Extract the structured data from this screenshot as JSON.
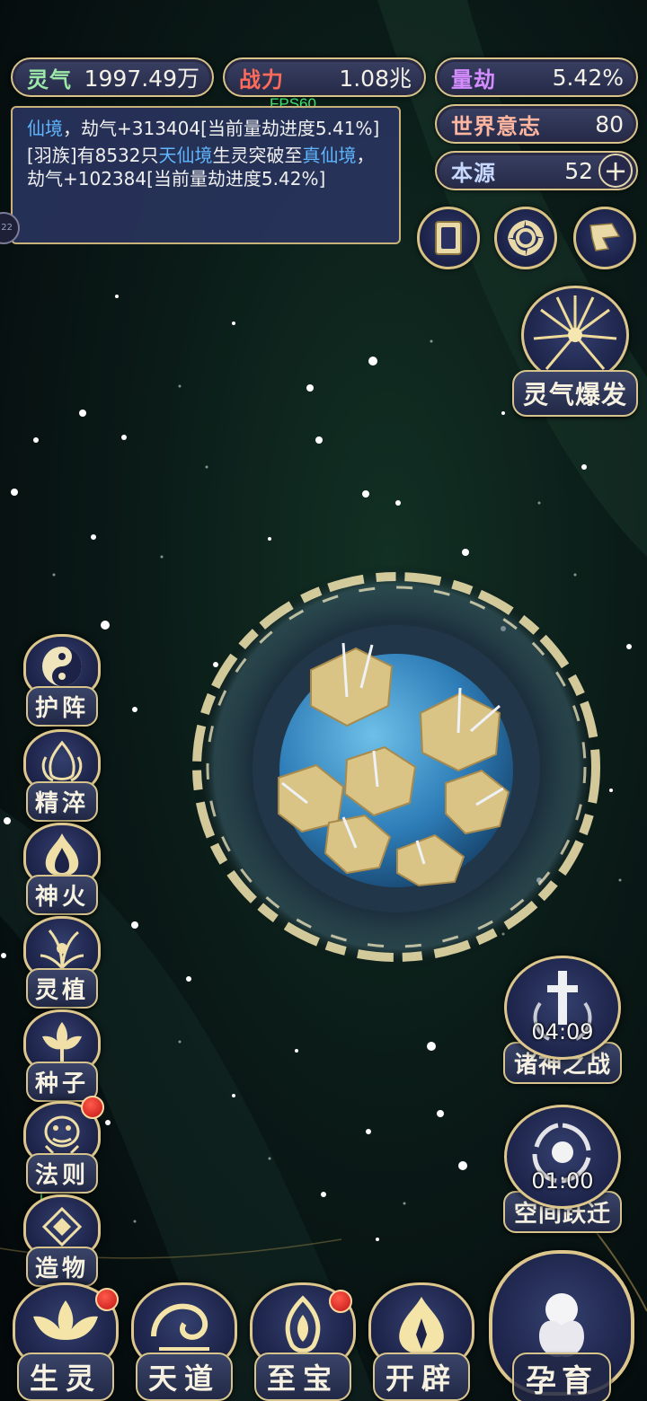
{
  "stats": {
    "lingqi": {
      "label": "灵气",
      "value": "1997.49万"
    },
    "zhanli": {
      "label": "战力",
      "value": "1.08兆"
    },
    "liangjie": {
      "label": "量劫",
      "value": "5.42%"
    },
    "shijie": {
      "label": "世界意志",
      "value": "80"
    },
    "benyuan": {
      "label": "本源",
      "value": "52",
      "plus": "+"
    }
  },
  "fps": "FPS60",
  "log": {
    "line1_a": "仙境",
    "line1_b": "，劫气+313404[当前量劫进度5.41%]",
    "line2_a": "[羽族]有8532只",
    "line2_b": "天仙境",
    "line2_c": "生灵突破至",
    "line2_d": "真仙境",
    "line2_e": "，劫气+102384[当前量劫进度5.42%]",
    "side_tab": "22"
  },
  "burst": {
    "label": "灵气爆发"
  },
  "side_buttons": {
    "huzhen": "护阵",
    "jingcui": "精淬",
    "shenhuo": "神火",
    "lingzhi": "灵植",
    "zhongzi": "种子",
    "faze": "法则",
    "zaowu": "造物"
  },
  "timers": {
    "zhushen": {
      "label": "诸神之战",
      "time": "04:09"
    },
    "kongjian": {
      "label": "空间跃迁",
      "time": "01:00"
    }
  },
  "bottom": {
    "shengling": "生灵",
    "tiandao": "天道",
    "zhibao": "至宝",
    "kaipi": "开辟",
    "yunyu": "孕育"
  },
  "colors": {
    "gold": "#d8c48a",
    "panel": "#2a3460",
    "highlight_blue": "#5fb6ff",
    "fps_green": "#3fe06a",
    "notify_red": "#c21616"
  }
}
